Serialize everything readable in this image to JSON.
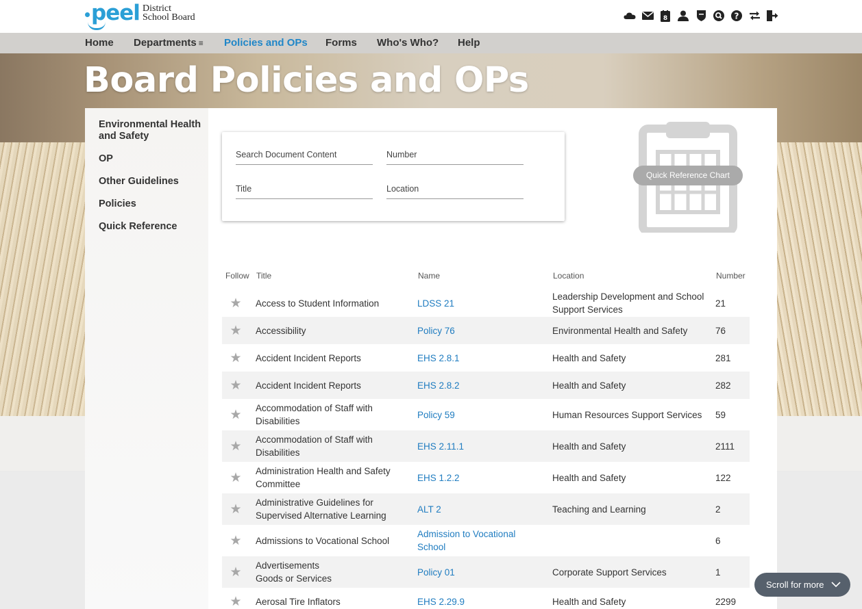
{
  "brand": {
    "wordmark": "peel",
    "board_line1": "District",
    "board_line2": "School Board",
    "color": "#2b9fd6"
  },
  "utility_icons": [
    "cloud-icon",
    "mail-icon",
    "calendar-icon",
    "user-icon",
    "shield-icon",
    "search-icon",
    "help-icon",
    "switch-icon",
    "logout-icon"
  ],
  "calendar_day": "8",
  "nav": {
    "items": [
      {
        "label": "Home"
      },
      {
        "label": "Departments",
        "suffix": "≡"
      },
      {
        "label": "Policies and OPs",
        "active": true
      },
      {
        "label": "Forms"
      },
      {
        "label": "Who's Who?"
      },
      {
        "label": "Help"
      }
    ],
    "active_color": "#1f86c8"
  },
  "page_title": "Board Policies and OPs",
  "sidebar": {
    "items": [
      {
        "label": "Environmental Health and Safety"
      },
      {
        "label": "OP"
      },
      {
        "label": "Other Guidelines"
      },
      {
        "label": "Policies"
      },
      {
        "label": "Quick Reference"
      }
    ]
  },
  "search": {
    "content_placeholder": "Search Document Content",
    "number_placeholder": "Number",
    "title_placeholder": "Title",
    "location_placeholder": "Location"
  },
  "quick_reference": {
    "label": "Quick Reference Chart"
  },
  "table": {
    "headers": {
      "follow": "Follow",
      "title": "Title",
      "name": "Name",
      "location": "Location",
      "number": "Number"
    },
    "link_color": "#1f7cc0",
    "rows": [
      {
        "title": "Access to Student Information",
        "name": "LDSS 21",
        "location": "Leadership Development and School Support Services",
        "number": "21"
      },
      {
        "title": "Accessibility",
        "name": "Policy 76",
        "location": "Environmental Health and Safety",
        "number": "76"
      },
      {
        "title": "Accident Incident Reports",
        "name": "EHS 2.8.1",
        "location": "Health and Safety",
        "number": "281"
      },
      {
        "title": "Accident Incident Reports",
        "name": "EHS 2.8.2",
        "location": "Health and Safety",
        "number": "282"
      },
      {
        "title": "Accommodation of Staff with Disabilities",
        "name": "Policy 59",
        "location": "Human Resources Support Services",
        "number": "59"
      },
      {
        "title": "Accommodation of Staff with Disabilities",
        "name": "EHS 2.11.1",
        "location": "Health and Safety",
        "number": "2111"
      },
      {
        "title": "Administration Health and Safety Committee",
        "name": "EHS 1.2.2",
        "location": "Health and Safety",
        "number": "122"
      },
      {
        "title": "Administrative Guidelines for Supervised Alternative Learning",
        "name": "ALT 2",
        "location": "Teaching and Learning",
        "number": "2"
      },
      {
        "title": "Admissions to Vocational School",
        "name": "Admission to Vocational School",
        "location": "",
        "number": "6"
      },
      {
        "title": "Advertisements Goods or Services",
        "name": "Policy 01",
        "location": "Corporate Support Services",
        "number": "1"
      },
      {
        "title": "Aerosal Tire Inflators",
        "name": "EHS 2.29.9",
        "location": "Health and Safety",
        "number": "2299"
      }
    ]
  },
  "scroll_more": {
    "label": "Scroll for more"
  }
}
